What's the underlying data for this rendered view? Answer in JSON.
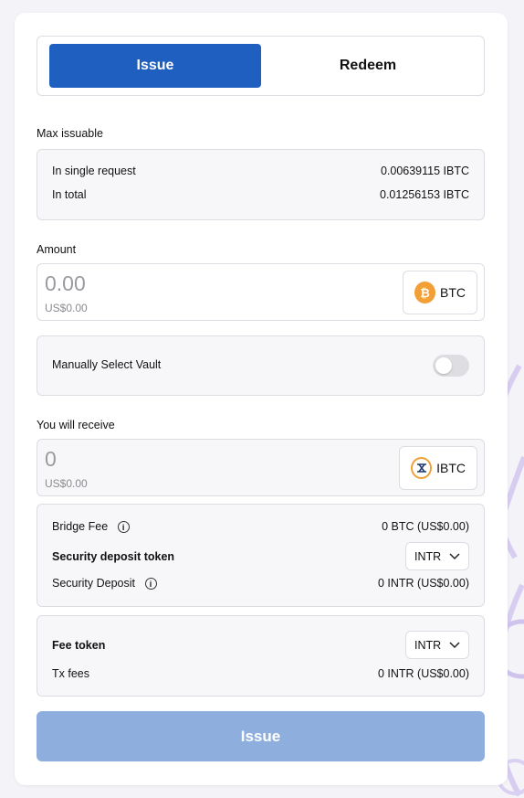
{
  "tabs": {
    "issue": "Issue",
    "redeem": "Redeem"
  },
  "max_issuable": {
    "label": "Max issuable",
    "single_label": "In single request",
    "single_value": "0.00639115 IBTC",
    "total_label": "In total",
    "total_value": "0.01256153 IBTC"
  },
  "amount": {
    "label": "Amount",
    "value": "0.00",
    "usd": "US$0.00",
    "token": "BTC"
  },
  "vault": {
    "label": "Manually Select Vault",
    "enabled": false
  },
  "receive": {
    "label": "You will receive",
    "value": "0",
    "usd": "US$0.00",
    "token": "IBTC"
  },
  "fees": {
    "bridge_fee_label": "Bridge Fee",
    "bridge_fee_value": "0 BTC (US$0.00)",
    "deposit_token_label": "Security deposit token",
    "deposit_token_value": "INTR",
    "deposit_label": "Security Deposit",
    "deposit_value": "0 INTR (US$0.00)"
  },
  "tx": {
    "fee_token_label": "Fee token",
    "fee_token_value": "INTR",
    "tx_fees_label": "Tx fees",
    "tx_fees_value": "0 INTR (US$0.00)"
  },
  "submit_label": "Issue",
  "colors": {
    "primary": "#1f5fbf",
    "disabled": "#8eaede",
    "btc": "#f2a035"
  }
}
